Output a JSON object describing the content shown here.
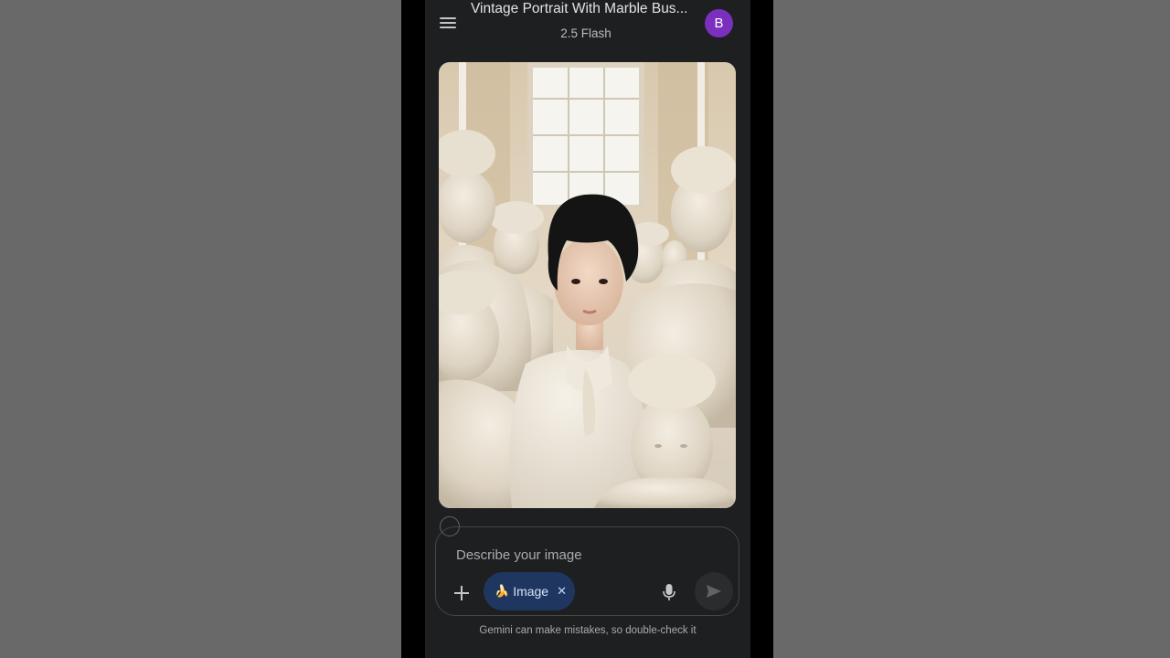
{
  "header": {
    "title": "Vintage Portrait With Marble Bus...",
    "model": "2.5 Flash",
    "avatar_letter": "B",
    "avatar_color": "#7b2fbe",
    "menu_icon": "hamburger-menu-icon"
  },
  "generated_image": {
    "subject": "young man in white ruffled shirt surrounded by classical marble busts"
  },
  "composer": {
    "placeholder": "Describe your image",
    "value": "",
    "chip_emoji": "🍌",
    "chip_label": "Image",
    "chip_close": "✕",
    "plus_icon": "plus-icon",
    "mic_icon": "microphone-icon",
    "send_icon": "send-icon"
  },
  "footer": {
    "disclaimer": "Gemini can make mistakes, so double-check it"
  },
  "colors": {
    "screen_bg": "#1e1f20",
    "chip_bg": "#1f3760",
    "chip_text": "#a8c7fa",
    "page_bg": "#696969"
  }
}
